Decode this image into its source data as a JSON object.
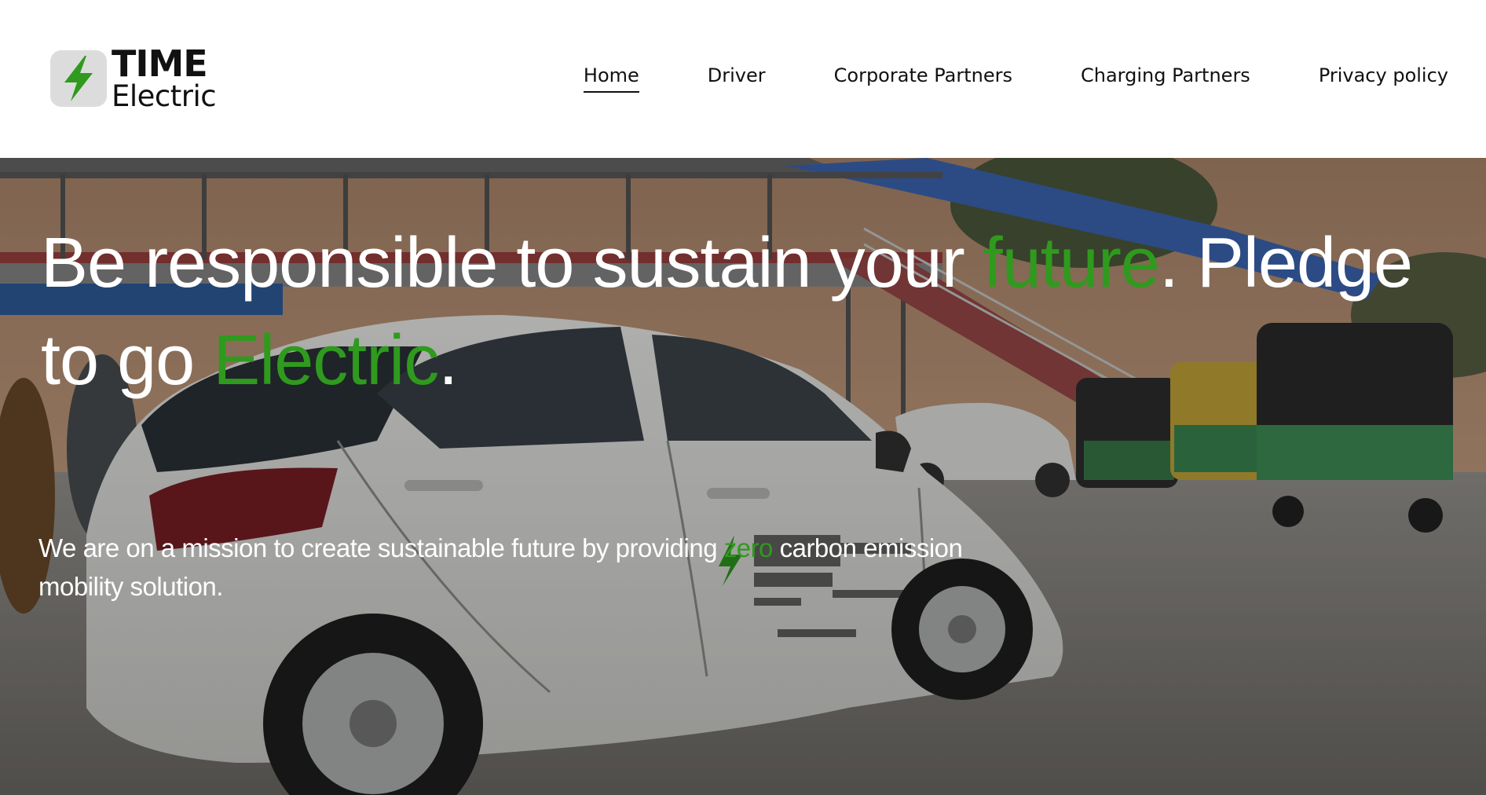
{
  "logo": {
    "line1": "TIME",
    "line2": "Electric",
    "icon": "lightning-bolt-icon",
    "badge_color": "#dcdcdc",
    "bolt_color": "#2f9a1e"
  },
  "nav": {
    "items": [
      {
        "label": "Home",
        "active": true
      },
      {
        "label": "Driver",
        "active": false
      },
      {
        "label": "Corporate Partners",
        "active": false
      },
      {
        "label": "Charging Partners",
        "active": false
      },
      {
        "label": "Privacy policy",
        "active": false
      }
    ]
  },
  "hero": {
    "headline": {
      "part1": "Be responsible to sustain your ",
      "highlight1": "future",
      "part2": ". Pledge to go ",
      "highlight2": "Electric",
      "part3": "."
    },
    "mission": {
      "part1": "We are on a mission to create sustainable future by providing ",
      "highlight": "zero",
      "part2": " carbon emission mobility solution."
    },
    "accent_color": "#2f9a1e",
    "text_color": "#ffffff"
  }
}
